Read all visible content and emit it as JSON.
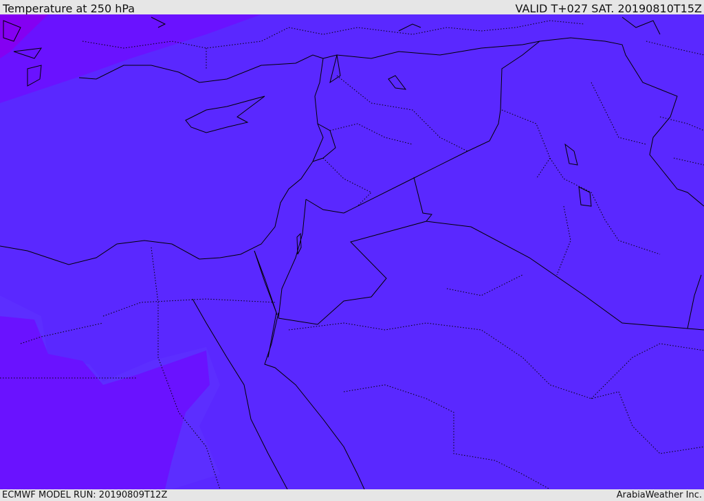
{
  "header": {
    "title": "Temperature at 250 hPa",
    "valid": "VALID T+027 SAT. 20190810T15Z"
  },
  "footer": {
    "model_run": "ECMWF MODEL RUN: 20190809T12Z",
    "credit": "ArabiaWeather Inc."
  },
  "colors": {
    "field_main": "#5a28ff",
    "field_light": "#5c2eff",
    "field_cold": "#6a12ff",
    "field_coldest": "#8400f2",
    "coastline": "#000000",
    "bar_background": "#e6e6e6"
  },
  "map": {
    "layers": [
      "temperature-field",
      "coastlines",
      "country-borders",
      "province-borders"
    ]
  }
}
